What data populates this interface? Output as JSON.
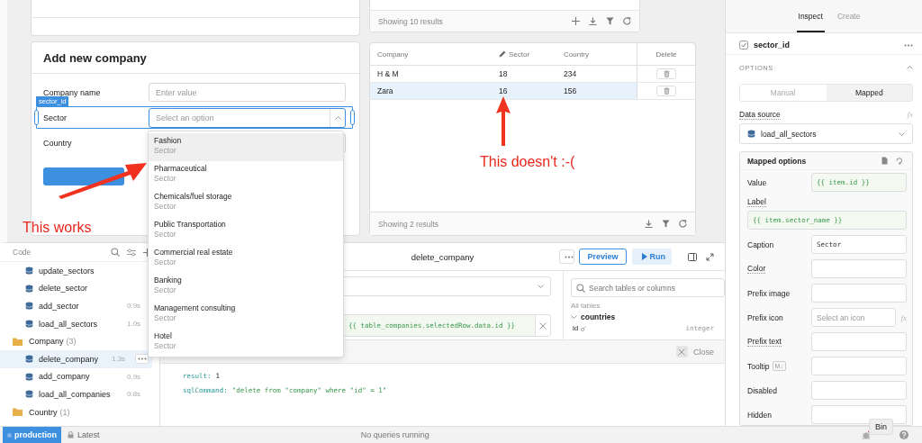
{
  "canvas": {
    "top_table": {
      "footer": "Showing 10 results"
    },
    "form": {
      "title": "Add new company",
      "fields": [
        {
          "label": "Company name",
          "kind": "text",
          "placeholder": "Enter value",
          "selected": false
        },
        {
          "label": "Sector",
          "kind": "select",
          "placeholder": "Select an option",
          "selected": true,
          "tag": "sector_id",
          "expanded": true
        },
        {
          "label": "Country",
          "kind": "select",
          "selected": false,
          "expanded": false
        }
      ]
    },
    "dropdown": {
      "options": [
        {
          "label": "Fashion",
          "caption": "Sector",
          "selected": true
        },
        {
          "label": "Pharmaceutical",
          "caption": "Sector",
          "selected": false
        },
        {
          "label": "Chemicals/fuel storage",
          "caption": "Sector",
          "selected": false
        },
        {
          "label": "Public Transportation",
          "caption": "Sector",
          "selected": false
        },
        {
          "label": "Commercial real estate",
          "caption": "Sector",
          "selected": false
        },
        {
          "label": "Banking",
          "caption": "Sector",
          "selected": false
        },
        {
          "label": "Management consulting",
          "caption": "Sector",
          "selected": false
        },
        {
          "label": "Hotel",
          "caption": "Sector",
          "selected": false
        }
      ]
    },
    "table": {
      "columns": [
        {
          "label": "Company",
          "editable": false
        },
        {
          "label": "Sector",
          "editable": true
        },
        {
          "label": "Country",
          "editable": false
        },
        {
          "label": "Delete",
          "editable": false
        }
      ],
      "rows": [
        {
          "cells": [
            "H & M",
            "18",
            "234"
          ],
          "selected": false
        },
        {
          "cells": [
            "Zara",
            "16",
            "156"
          ],
          "selected": true
        }
      ],
      "footer": "Showing 2 results"
    },
    "annotations": [
      {
        "text": "This works"
      },
      {
        "text": "This doesn't :-("
      }
    ]
  },
  "code_panel": {
    "title": "Code",
    "tree": [
      {
        "kind": "group",
        "children": [
          {
            "kind": "query",
            "name": "update_sectors",
            "selected": false
          },
          {
            "kind": "query",
            "name": "delete_sector",
            "selected": false
          },
          {
            "kind": "query",
            "name": "add_sector",
            "time": "0.9s",
            "selected": false
          },
          {
            "kind": "query",
            "name": "load_all_sectors",
            "time": "1.0s",
            "selected": false
          }
        ]
      },
      {
        "kind": "folder",
        "name": "Company",
        "count": "(3)",
        "children": [
          {
            "kind": "query",
            "name": "delete_company",
            "time": "1.3s",
            "selected": true
          },
          {
            "kind": "query",
            "name": "add_company",
            "time": "0.9s",
            "selected": false
          },
          {
            "kind": "query",
            "name": "load_all_companies",
            "time": "0.8s",
            "selected": false
          }
        ]
      },
      {
        "kind": "folder",
        "name": "Country",
        "count": "(1)"
      }
    ]
  },
  "editor": {
    "title": "delete_company",
    "preview": "Preview",
    "run": "Run",
    "params": [
      {
        "value": "{{ table_companies.selectedRow.data.id }}"
      }
    ],
    "schema": {
      "search_placeholder": "Search tables or columns",
      "heading": "All tables",
      "tables": [
        {
          "name": "countries",
          "columns": [
            {
              "name": "id",
              "type": "integer"
            }
          ]
        }
      ]
    },
    "results": {
      "close": "Close",
      "lines": [
        {
          "key": "result:",
          "value": "1",
          "kind": "number"
        },
        {
          "key": "sqlCommand:",
          "value": "\"delete from \"company\" where \"id\" = 1\"",
          "kind": "string"
        }
      ]
    }
  },
  "inspector": {
    "tabs": [
      {
        "label": "Inspect",
        "selected": true
      },
      {
        "label": "Create",
        "selected": false
      }
    ],
    "component": "sector_id",
    "section": "OPTIONS",
    "modes": [
      {
        "label": "Manual",
        "selected": false
      },
      {
        "label": "Mapped",
        "selected": true
      }
    ],
    "data_source": {
      "label": "Data source",
      "fx": "fx",
      "value": "load_all_sectors"
    },
    "mapped": {
      "title": "Mapped options",
      "fields": [
        {
          "label": "Value",
          "kind": "inline",
          "template": true,
          "underlined": false,
          "value": "{{ item.id }}"
        },
        {
          "label": "Label",
          "kind": "stacked",
          "template": true,
          "underlined": true,
          "value": "{{ item.sector_name }}"
        },
        {
          "label": "Caption",
          "kind": "inline",
          "template": false,
          "underlined": false,
          "value": "Sector"
        },
        {
          "label": "Color",
          "kind": "inline",
          "template": false,
          "underlined": true
        },
        {
          "label": "Prefix image",
          "kind": "inline",
          "template": false,
          "underlined": false
        },
        {
          "label": "Prefix icon",
          "kind": "inline",
          "template": false,
          "underlined": false,
          "placeholder": "Select an icon",
          "fx": "fx"
        },
        {
          "label": "Prefix text",
          "kind": "inline",
          "template": false,
          "underlined": true
        },
        {
          "label": "Tooltip",
          "kind": "inline",
          "template": false,
          "underlined": false,
          "badge": "M↓"
        },
        {
          "label": "Disabled",
          "kind": "inline",
          "template": false,
          "underlined": false
        },
        {
          "label": "Hidden",
          "kind": "inline",
          "template": false,
          "underlined": false
        }
      ]
    }
  },
  "status_bar": {
    "environment": "production",
    "version": "Latest",
    "message": "No queries running",
    "tooltip": "Bin"
  }
}
